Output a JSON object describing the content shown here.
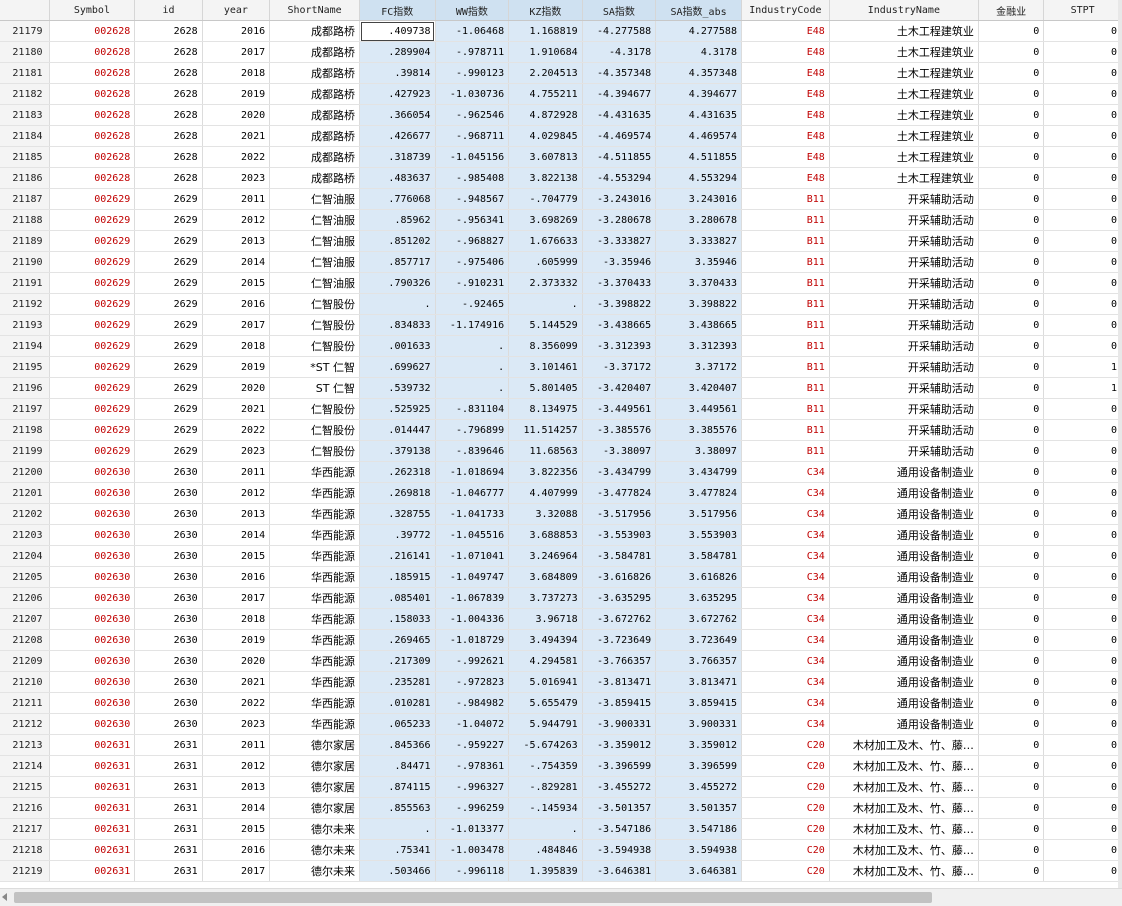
{
  "columns": [
    "",
    "Symbol",
    "id",
    "year",
    "ShortName",
    "FC指数",
    "WW指数",
    "KZ指数",
    "SA指数",
    "SA指数_abs",
    "IndustryCode",
    "IndustryName",
    "金融业",
    "STPT"
  ],
  "selected_columns": [
    5,
    6,
    7,
    8,
    9
  ],
  "active_cell": {
    "row": 0,
    "col": 5
  },
  "rows": [
    [
      "21179",
      "002628",
      "2628",
      "2016",
      "成都路桥",
      ".409738",
      "-1.06468",
      "1.168819",
      "-4.277588",
      "4.277588",
      "E48",
      "土木工程建筑业",
      "0",
      "0"
    ],
    [
      "21180",
      "002628",
      "2628",
      "2017",
      "成都路桥",
      ".289904",
      "-.978711",
      "1.910684",
      "-4.3178",
      "4.3178",
      "E48",
      "土木工程建筑业",
      "0",
      "0"
    ],
    [
      "21181",
      "002628",
      "2628",
      "2018",
      "成都路桥",
      ".39814",
      "-.990123",
      "2.204513",
      "-4.357348",
      "4.357348",
      "E48",
      "土木工程建筑业",
      "0",
      "0"
    ],
    [
      "21182",
      "002628",
      "2628",
      "2019",
      "成都路桥",
      ".427923",
      "-1.030736",
      "4.755211",
      "-4.394677",
      "4.394677",
      "E48",
      "土木工程建筑业",
      "0",
      "0"
    ],
    [
      "21183",
      "002628",
      "2628",
      "2020",
      "成都路桥",
      ".366054",
      "-.962546",
      "4.872928",
      "-4.431635",
      "4.431635",
      "E48",
      "土木工程建筑业",
      "0",
      "0"
    ],
    [
      "21184",
      "002628",
      "2628",
      "2021",
      "成都路桥",
      ".426677",
      "-.968711",
      "4.029845",
      "-4.469574",
      "4.469574",
      "E48",
      "土木工程建筑业",
      "0",
      "0"
    ],
    [
      "21185",
      "002628",
      "2628",
      "2022",
      "成都路桥",
      ".318739",
      "-1.045156",
      "3.607813",
      "-4.511855",
      "4.511855",
      "E48",
      "土木工程建筑业",
      "0",
      "0"
    ],
    [
      "21186",
      "002628",
      "2628",
      "2023",
      "成都路桥",
      ".483637",
      "-.985408",
      "3.822138",
      "-4.553294",
      "4.553294",
      "E48",
      "土木工程建筑业",
      "0",
      "0"
    ],
    [
      "21187",
      "002629",
      "2629",
      "2011",
      "仁智油服",
      ".776068",
      "-.948567",
      "-.704779",
      "-3.243016",
      "3.243016",
      "B11",
      "开采辅助活动",
      "0",
      "0"
    ],
    [
      "21188",
      "002629",
      "2629",
      "2012",
      "仁智油服",
      ".85962",
      "-.956341",
      "3.698269",
      "-3.280678",
      "3.280678",
      "B11",
      "开采辅助活动",
      "0",
      "0"
    ],
    [
      "21189",
      "002629",
      "2629",
      "2013",
      "仁智油服",
      ".851202",
      "-.968827",
      "1.676633",
      "-3.333827",
      "3.333827",
      "B11",
      "开采辅助活动",
      "0",
      "0"
    ],
    [
      "21190",
      "002629",
      "2629",
      "2014",
      "仁智油服",
      ".857717",
      "-.975406",
      ".605999",
      "-3.35946",
      "3.35946",
      "B11",
      "开采辅助活动",
      "0",
      "0"
    ],
    [
      "21191",
      "002629",
      "2629",
      "2015",
      "仁智油服",
      ".790326",
      "-.910231",
      "2.373332",
      "-3.370433",
      "3.370433",
      "B11",
      "开采辅助活动",
      "0",
      "0"
    ],
    [
      "21192",
      "002629",
      "2629",
      "2016",
      "仁智股份",
      ".",
      "-.92465",
      ".",
      "-3.398822",
      "3.398822",
      "B11",
      "开采辅助活动",
      "0",
      "0"
    ],
    [
      "21193",
      "002629",
      "2629",
      "2017",
      "仁智股份",
      ".834833",
      "-1.174916",
      "5.144529",
      "-3.438665",
      "3.438665",
      "B11",
      "开采辅助活动",
      "0",
      "0"
    ],
    [
      "21194",
      "002629",
      "2629",
      "2018",
      "仁智股份",
      ".001633",
      ".",
      "8.356099",
      "-3.312393",
      "3.312393",
      "B11",
      "开采辅助活动",
      "0",
      "0"
    ],
    [
      "21195",
      "002629",
      "2629",
      "2019",
      "*ST 仁智",
      ".699627",
      ".",
      "3.101461",
      "-3.37172",
      "3.37172",
      "B11",
      "开采辅助活动",
      "0",
      "1"
    ],
    [
      "21196",
      "002629",
      "2629",
      "2020",
      "ST 仁智",
      ".539732",
      ".",
      "5.801405",
      "-3.420407",
      "3.420407",
      "B11",
      "开采辅助活动",
      "0",
      "1"
    ],
    [
      "21197",
      "002629",
      "2629",
      "2021",
      "仁智股份",
      ".525925",
      "-.831104",
      "8.134975",
      "-3.449561",
      "3.449561",
      "B11",
      "开采辅助活动",
      "0",
      "0"
    ],
    [
      "21198",
      "002629",
      "2629",
      "2022",
      "仁智股份",
      ".014447",
      "-.796899",
      "11.514257",
      "-3.385576",
      "3.385576",
      "B11",
      "开采辅助活动",
      "0",
      "0"
    ],
    [
      "21199",
      "002629",
      "2629",
      "2023",
      "仁智股份",
      ".379138",
      "-.839646",
      "11.68563",
      "-3.38097",
      "3.38097",
      "B11",
      "开采辅助活动",
      "0",
      "0"
    ],
    [
      "21200",
      "002630",
      "2630",
      "2011",
      "华西能源",
      ".262318",
      "-1.018694",
      "3.822356",
      "-3.434799",
      "3.434799",
      "C34",
      "通用设备制造业",
      "0",
      "0"
    ],
    [
      "21201",
      "002630",
      "2630",
      "2012",
      "华西能源",
      ".269818",
      "-1.046777",
      "4.407999",
      "-3.477824",
      "3.477824",
      "C34",
      "通用设备制造业",
      "0",
      "0"
    ],
    [
      "21202",
      "002630",
      "2630",
      "2013",
      "华西能源",
      ".328755",
      "-1.041733",
      "3.32088",
      "-3.517956",
      "3.517956",
      "C34",
      "通用设备制造业",
      "0",
      "0"
    ],
    [
      "21203",
      "002630",
      "2630",
      "2014",
      "华西能源",
      ".39772",
      "-1.045516",
      "3.688853",
      "-3.553903",
      "3.553903",
      "C34",
      "通用设备制造业",
      "0",
      "0"
    ],
    [
      "21204",
      "002630",
      "2630",
      "2015",
      "华西能源",
      ".216141",
      "-1.071041",
      "3.246964",
      "-3.584781",
      "3.584781",
      "C34",
      "通用设备制造业",
      "0",
      "0"
    ],
    [
      "21205",
      "002630",
      "2630",
      "2016",
      "华西能源",
      ".185915",
      "-1.049747",
      "3.684809",
      "-3.616826",
      "3.616826",
      "C34",
      "通用设备制造业",
      "0",
      "0"
    ],
    [
      "21206",
      "002630",
      "2630",
      "2017",
      "华西能源",
      ".085401",
      "-1.067839",
      "3.737273",
      "-3.635295",
      "3.635295",
      "C34",
      "通用设备制造业",
      "0",
      "0"
    ],
    [
      "21207",
      "002630",
      "2630",
      "2018",
      "华西能源",
      ".158033",
      "-1.004336",
      "3.96718",
      "-3.672762",
      "3.672762",
      "C34",
      "通用设备制造业",
      "0",
      "0"
    ],
    [
      "21208",
      "002630",
      "2630",
      "2019",
      "华西能源",
      ".269465",
      "-1.018729",
      "3.494394",
      "-3.723649",
      "3.723649",
      "C34",
      "通用设备制造业",
      "0",
      "0"
    ],
    [
      "21209",
      "002630",
      "2630",
      "2020",
      "华西能源",
      ".217309",
      "-.992621",
      "4.294581",
      "-3.766357",
      "3.766357",
      "C34",
      "通用设备制造业",
      "0",
      "0"
    ],
    [
      "21210",
      "002630",
      "2630",
      "2021",
      "华西能源",
      ".235281",
      "-.972823",
      "5.016941",
      "-3.813471",
      "3.813471",
      "C34",
      "通用设备制造业",
      "0",
      "0"
    ],
    [
      "21211",
      "002630",
      "2630",
      "2022",
      "华西能源",
      ".010281",
      "-.984982",
      "5.655479",
      "-3.859415",
      "3.859415",
      "C34",
      "通用设备制造业",
      "0",
      "0"
    ],
    [
      "21212",
      "002630",
      "2630",
      "2023",
      "华西能源",
      ".065233",
      "-1.04072",
      "5.944791",
      "-3.900331",
      "3.900331",
      "C34",
      "通用设备制造业",
      "0",
      "0"
    ],
    [
      "21213",
      "002631",
      "2631",
      "2011",
      "德尔家居",
      ".845366",
      "-.959227",
      "-5.674263",
      "-3.359012",
      "3.359012",
      "C20",
      "木材加工及木、竹、藤…",
      "0",
      "0"
    ],
    [
      "21214",
      "002631",
      "2631",
      "2012",
      "德尔家居",
      ".84471",
      "-.978361",
      "-.754359",
      "-3.396599",
      "3.396599",
      "C20",
      "木材加工及木、竹、藤…",
      "0",
      "0"
    ],
    [
      "21215",
      "002631",
      "2631",
      "2013",
      "德尔家居",
      ".874115",
      "-.996327",
      "-.829281",
      "-3.455272",
      "3.455272",
      "C20",
      "木材加工及木、竹、藤…",
      "0",
      "0"
    ],
    [
      "21216",
      "002631",
      "2631",
      "2014",
      "德尔家居",
      ".855563",
      "-.996259",
      "-.145934",
      "-3.501357",
      "3.501357",
      "C20",
      "木材加工及木、竹、藤…",
      "0",
      "0"
    ],
    [
      "21217",
      "002631",
      "2631",
      "2015",
      "德尔未来",
      ".",
      "-1.013377",
      ".",
      "-3.547186",
      "3.547186",
      "C20",
      "木材加工及木、竹、藤…",
      "0",
      "0"
    ],
    [
      "21218",
      "002631",
      "2631",
      "2016",
      "德尔未来",
      ".75341",
      "-1.003478",
      ".484846",
      "-3.594938",
      "3.594938",
      "C20",
      "木材加工及木、竹、藤…",
      "0",
      "0"
    ],
    [
      "21219",
      "002631",
      "2631",
      "2017",
      "德尔未来",
      ".503466",
      "-.996118",
      "1.395839",
      "-3.646381",
      "3.646381",
      "C20",
      "木材加工及木、竹、藤…",
      "0",
      "0"
    ]
  ]
}
